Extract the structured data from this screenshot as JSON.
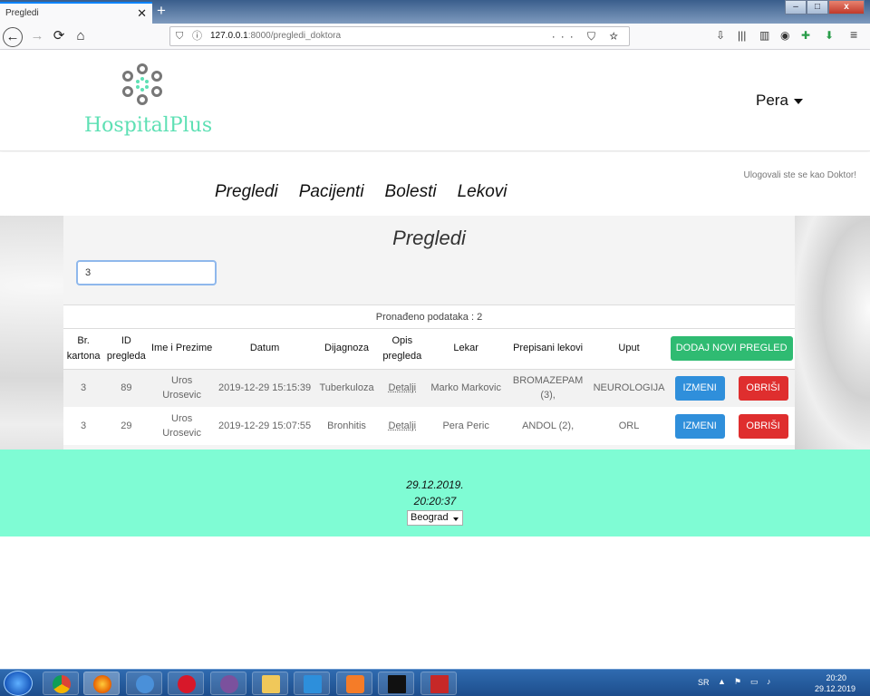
{
  "browser": {
    "tab_title": "Pregledi",
    "tab_close": "✕",
    "new_tab": "+",
    "url_host": "127.0.0.1",
    "url_rest": ":8000/pregledi_doktora",
    "url_actions": "··· ⛉ ☆",
    "back": "←",
    "forward": "→",
    "reload": "⟳",
    "home": "⌂",
    "window_controls": [
      "–",
      "□",
      "x"
    ]
  },
  "header": {
    "brand": "HospitalPlus",
    "user": "Pera"
  },
  "nav": {
    "login_note": "Ulogovali ste se kao Doktor!",
    "items": [
      "Pregledi",
      "Pacijenti",
      "Bolesti",
      "Lekovi"
    ]
  },
  "main": {
    "title": "Pregledi",
    "search_value": "3",
    "found_text": "Pronađeno podataka : 2",
    "columns": [
      "Br. kartona",
      "ID pregleda",
      "Ime i Prezime",
      "Datum",
      "Dijagnoza",
      "Opis pregleda",
      "Lekar",
      "Prepisani lekovi",
      "Uput"
    ],
    "add_button": "DODAJ NOVI PREGLED",
    "edit_button": "IZMENI",
    "delete_button": "OBRIŠI",
    "rows": [
      {
        "kartona": "3",
        "id": "89",
        "ime": "Uros Urosevic",
        "datum": "2019-12-29 15:15:39",
        "dijagnoza": "Tuberkuloza",
        "opis": "Detalji",
        "lekar": "Marko Markovic",
        "lekovi": "BROMAZEPAM (3),",
        "uput": "NEUROLOGIJA"
      },
      {
        "kartona": "3",
        "id": "29",
        "ime": "Uros Urosevic",
        "datum": "2019-12-29 15:07:55",
        "dijagnoza": "Bronhitis",
        "opis": "Detalji",
        "lekar": "Pera Peric",
        "lekovi": "ANDOL (2),",
        "uput": "ORL"
      }
    ]
  },
  "footer": {
    "date": "29.12.2019.",
    "time": "20:20:37",
    "city": "Beograd"
  },
  "taskbar": {
    "lang": "SR",
    "time": "20:20",
    "date": "29.12.2019"
  },
  "colors": {
    "brand": "#5ee0b4",
    "footer": "#7ffcd4",
    "add": "#2fbb72",
    "edit": "#2f8fdb",
    "delete": "#df2e2e"
  }
}
